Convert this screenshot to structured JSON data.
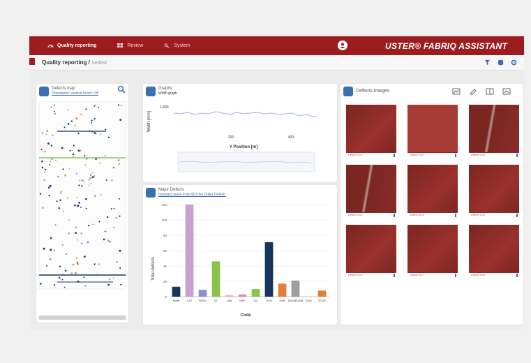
{
  "nav": {
    "items": [
      {
        "label": "Quality reporting",
        "icon": "gauge-icon"
      },
      {
        "label": "Review",
        "icon": "grid-icon"
      },
      {
        "label": "System",
        "icon": "wrench-icon"
      }
    ],
    "brand": "USTER® FABRIQ ASSISTANT"
  },
  "subbar": {
    "title": "Quality reporting /",
    "subtitle": "Settled"
  },
  "defects_map": {
    "title": "Defects map",
    "subtitle": "Orientation: Vertical  Invert: Off"
  },
  "graphs": {
    "title": "Graphs",
    "subtitle": "Width graph",
    "ylabel": "Width [mm]",
    "xlabel": "Y Position [m]",
    "ytick": "1,800",
    "xticks": [
      "200",
      "400"
    ]
  },
  "major": {
    "title": "Major Defects",
    "subtitle": "Statistics taken from 410 mm (Filter Defect)"
  },
  "images": {
    "title": "Defects images",
    "captions": [
      "Defect 01/2",
      "Defect 01/2",
      "Defect 01/2",
      "Defect 01/2",
      "Defect 01/4",
      "Defect 01/2",
      "Defect 01/3",
      "Defect 01/7",
      "Defect 01/4"
    ]
  },
  "chart_data": {
    "type": "bar",
    "categories": [
      "None",
      "CAT",
      "HOLE",
      "KT",
      "LAN",
      "NAP",
      "OIL",
      "OVO",
      "PAR",
      "SEAMSLAB",
      "SNG",
      "STOP"
    ],
    "values": [
      13,
      120,
      9,
      46,
      2,
      3,
      10,
      71,
      17,
      21,
      1,
      8
    ],
    "colors": [
      "#16365c",
      "#c9a0d2",
      "#8d8fd6",
      "#8ac34a",
      "#f0b1cf",
      "#f47fb0",
      "#8ac34a",
      "#16365c",
      "#e57e3c",
      "#9e9e9e",
      "#e0e0e0",
      "#e57e3c"
    ],
    "xlabel": "Code",
    "ylabel": "Total defects",
    "ylim": [
      0,
      120
    ],
    "yticks": [
      0,
      20,
      40,
      60,
      80,
      100,
      120
    ],
    "grid": true
  }
}
